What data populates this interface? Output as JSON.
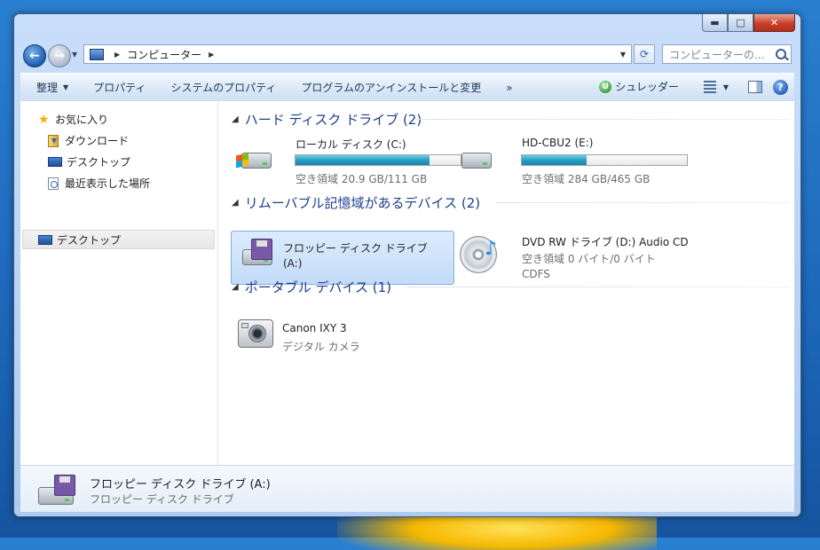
{
  "window": {
    "controls": {
      "minimize": "▬",
      "maximize": "□",
      "close": "✕"
    }
  },
  "nav": {
    "address": {
      "segments": [
        "コンピューター"
      ]
    },
    "search_placeholder": "コンピューターの..."
  },
  "toolbar": {
    "organize": "整理",
    "properties": "プロパティ",
    "system_properties": "システムのプロパティ",
    "uninstall": "プログラムのアンインストールと変更",
    "more": "»",
    "shredder": "シュレッダー",
    "help": "?"
  },
  "sidebar": {
    "favorites": "お気に入り",
    "items": [
      {
        "label": "ダウンロード"
      },
      {
        "label": "デスクトップ"
      },
      {
        "label": "最近表示した場所"
      }
    ],
    "desktop_root": "デスクトップ"
  },
  "groups": {
    "hard_disks": {
      "header": "ハード ディスク ドライブ (2)",
      "items": [
        {
          "name": "ローカル ディスク (C:)",
          "space": "空き領域 20.9 GB/111 GB",
          "used_fraction": 0.81
        },
        {
          "name": "HD-CBU2 (E:)",
          "space": "空き領域 284 GB/465 GB",
          "used_fraction": 0.39
        }
      ]
    },
    "removable": {
      "header": "リムーバブル記憶域があるデバイス (2)",
      "items": [
        {
          "name_line1": "フロッピー ディスク ドライブ",
          "name_line2": "(A:)"
        },
        {
          "name": "DVD RW ドライブ (D:) Audio CD",
          "space": "空き領域 0 バイト/0 バイト",
          "fs": "CDFS"
        }
      ]
    },
    "portable": {
      "header": "ポータブル デバイス (1)",
      "items": [
        {
          "name": "Canon IXY 3",
          "type": "デジタル カメラ"
        }
      ]
    }
  },
  "details": {
    "title": "フロッピー ディスク ドライブ (A:)",
    "subtitle": "フロッピー ディスク ドライブ"
  },
  "colors": {
    "bar_fill": "#25a0c4",
    "group_header": "#1e3f8a",
    "selection": "#c3dcf8"
  }
}
